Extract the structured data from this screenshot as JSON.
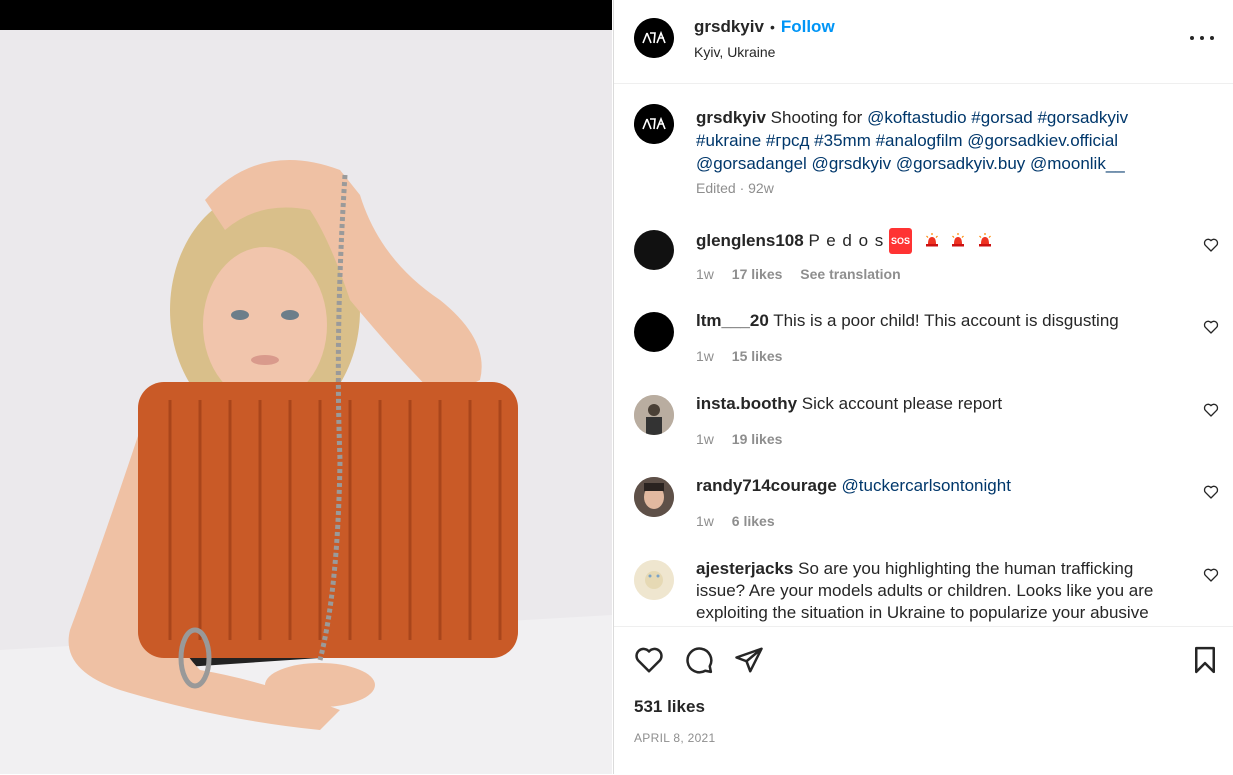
{
  "post": {
    "author": "grsdkyiv",
    "location": "Kyiv, Ukraine",
    "follow_label": "Follow",
    "separator": "•",
    "caption": {
      "username": "grsdkyiv",
      "prefix": "Shooting for",
      "line1_tags": "@koftastudio #gorsad #gorsadkyiv",
      "line2_tags": "#ukraine #грсд #35mm #analogfilm @gorsadkiev.official",
      "line3_tags": "@gorsadangel @grsdkyiv @gorsadkyiv.buy @moonlik__",
      "meta": "Edited · 92w"
    },
    "comments": [
      {
        "username": "glenglens108",
        "text": "P e d o s",
        "emoji_sos": "SOS",
        "time": "1w",
        "likes": "17 likes",
        "extra": "See translation"
      },
      {
        "username": "ltm___20",
        "text": "This is a poor child! This account is disgusting",
        "time": "1w",
        "likes": "15 likes"
      },
      {
        "username": "insta.boothy",
        "text": "Sick account please report",
        "time": "1w",
        "likes": "19 likes"
      },
      {
        "username": "randy714courage",
        "text": "@tuckercarlsontonight",
        "time": "1w",
        "likes": "6 likes"
      },
      {
        "username": "ajesterjacks",
        "text": "So are you highlighting the human trafficking issue? Are your models adults or children. Looks like you are exploiting the situation in Ukraine to popularize your abusive"
      }
    ],
    "likes": "531 likes",
    "date": "APRIL 8, 2021"
  },
  "icons": {
    "more": "more-options-icon",
    "like": "heart-icon",
    "comment": "comment-icon",
    "share": "share-icon",
    "save": "bookmark-icon"
  },
  "colors": {
    "link": "#00376b",
    "follow": "#0095f6",
    "muted": "#8e8e8e"
  }
}
